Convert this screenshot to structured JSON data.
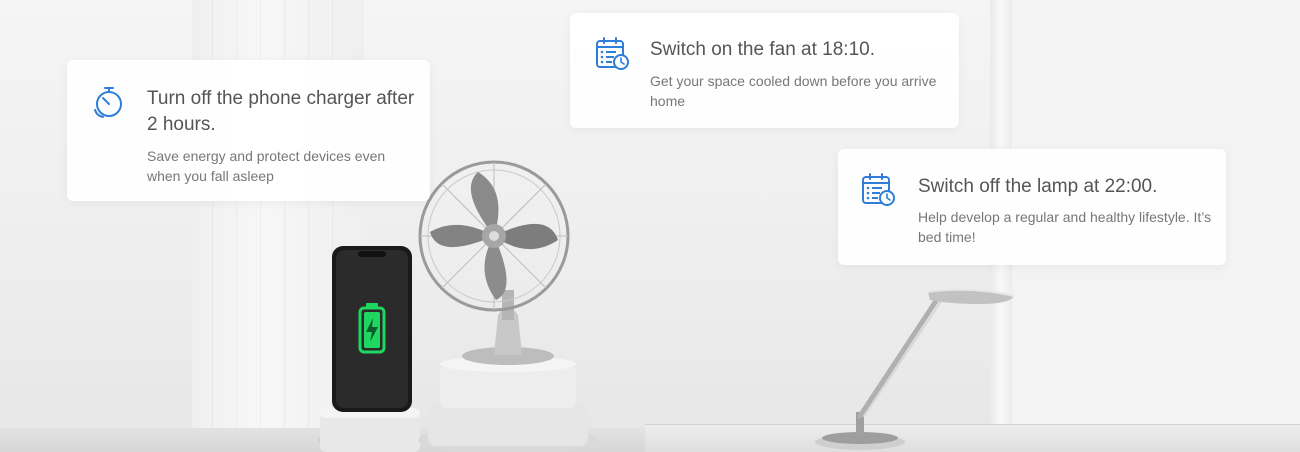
{
  "cards": {
    "charger": {
      "icon": "stopwatch-icon",
      "title": "Turn off the phone charger after 2 hours.",
      "description": "Save energy and protect devices even when you fall asleep"
    },
    "fan": {
      "icon": "schedule-calendar-icon",
      "title": "Switch on the fan at 18:10.",
      "description": "Get your space cooled down before you arrive home"
    },
    "lamp": {
      "icon": "schedule-calendar-icon",
      "title": "Switch off the lamp at 22:00.",
      "description": "Help develop a regular and healthy lifestyle. It’s bed time!"
    }
  },
  "colors": {
    "icon_blue": "#2f7fd8",
    "battery_green": "#1ed760",
    "card_title": "#555555",
    "card_desc": "#777777"
  },
  "illustrations": {
    "phone": "smartphone-charging",
    "fan": "desk-fan",
    "lamp": "desk-lamp"
  }
}
